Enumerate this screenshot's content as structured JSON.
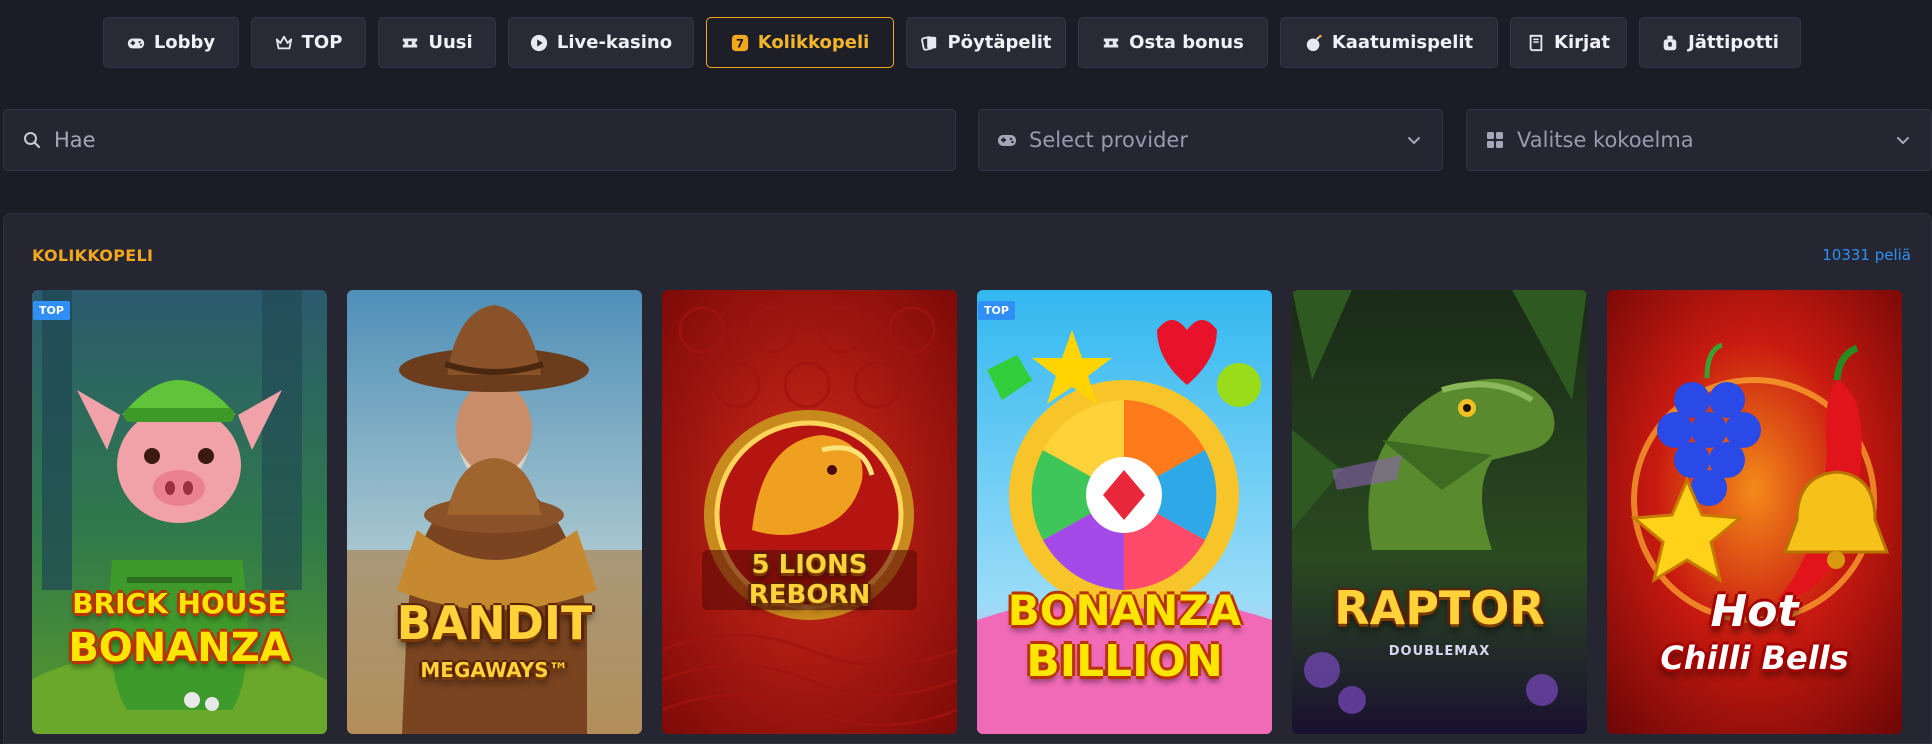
{
  "tabs": [
    {
      "label": "Lobby",
      "icon": "gamepad-icon",
      "active": false
    },
    {
      "label": "TOP",
      "icon": "crown-icon",
      "active": false
    },
    {
      "label": "Uusi",
      "icon": "ticket-icon",
      "active": false
    },
    {
      "label": "Live-kasino",
      "icon": "play-icon",
      "active": false
    },
    {
      "label": "Kolikkopeli",
      "icon": "slot-seven-icon",
      "active": true
    },
    {
      "label": "Pöytäpelit",
      "icon": "cards-icon",
      "active": false
    },
    {
      "label": "Osta bonus",
      "icon": "ticket-icon",
      "active": false
    },
    {
      "label": "Kaatumispelit",
      "icon": "bomb-icon",
      "active": false
    },
    {
      "label": "Kirjat",
      "icon": "book-icon",
      "active": false
    },
    {
      "label": "Jättipotti",
      "icon": "moneybag-icon",
      "active": false
    }
  ],
  "filters": {
    "search_placeholder": "Hae",
    "provider_placeholder": "Select provider",
    "collection_placeholder": "Valitse kokoelma"
  },
  "section": {
    "title": "KOLIKKOPELI",
    "count": "10331 peliä"
  },
  "games": [
    {
      "name": "Brick House Bonanza",
      "line1": "BRICK HOUSE",
      "line2": "BONANZA",
      "badge": "TOP"
    },
    {
      "name": "Bandit Megaways",
      "line1": "BANDIT",
      "line2": "MEGAWAYS™",
      "badge": ""
    },
    {
      "name": "5 Lions Reborn",
      "line1": "5 LIONS",
      "line2": "REBORN",
      "badge": ""
    },
    {
      "name": "Bonanza Billion",
      "line1": "BONANZA",
      "line2": "BILLION",
      "badge": "TOP"
    },
    {
      "name": "Raptor Doublemax",
      "line1": "RAPTOR",
      "line2": "DOUBLEMAX",
      "badge": ""
    },
    {
      "name": "Hot Chilli Bells",
      "line1": "Hot",
      "line2": "Chilli Bells",
      "badge": ""
    }
  ],
  "colors": {
    "background": "#1c1c26",
    "panel": "#262633",
    "accent": "#f2a81d",
    "link": "#2f8ff5"
  }
}
